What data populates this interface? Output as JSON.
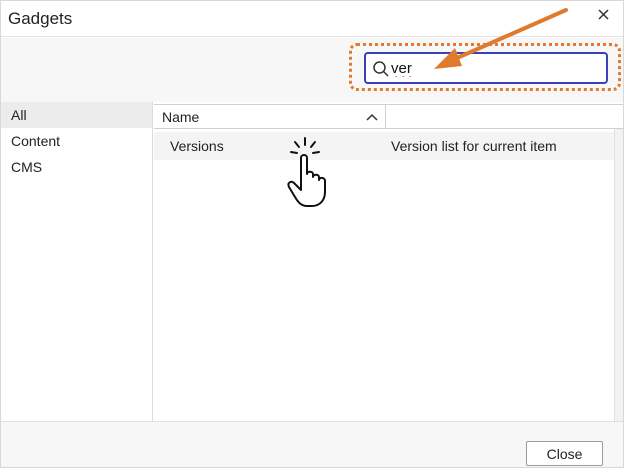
{
  "dialog": {
    "title": "Gadgets"
  },
  "search": {
    "value": "ver",
    "icon": "search-icon"
  },
  "sidebar": {
    "items": [
      {
        "label": "All",
        "active": true
      },
      {
        "label": "Content",
        "active": false
      },
      {
        "label": "CMS",
        "active": false
      }
    ]
  },
  "grid": {
    "columns": [
      {
        "label": "Name",
        "sort": "ascending"
      },
      {
        "label": ""
      }
    ],
    "rows": [
      {
        "name": "Versions",
        "description": "Version list for current item"
      }
    ]
  },
  "footer": {
    "close_label": "Close"
  },
  "colors": {
    "search_border": "#3a40b8",
    "annotation": "#e07a2e",
    "selected_row": "#f4f4f4"
  }
}
